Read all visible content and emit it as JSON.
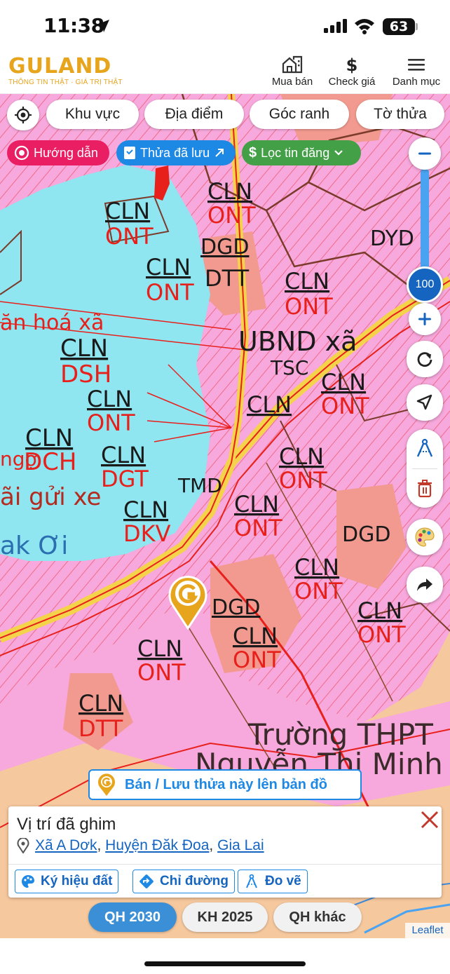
{
  "status_bar": {
    "time": "11:38",
    "battery": "63"
  },
  "header": {
    "logo": "GULAND",
    "tagline": "THÔNG TIN THẬT · GIÁ TRỊ THẬT",
    "nav": [
      {
        "label": "Mua bán",
        "icon": "house-icon"
      },
      {
        "label": "Check giá",
        "icon": "dollar-icon"
      },
      {
        "label": "Danh mục",
        "icon": "menu-icon"
      }
    ]
  },
  "filters": {
    "chips": [
      "Khu vực",
      "Địa điểm",
      "Góc ranh",
      "Tờ thửa"
    ]
  },
  "quick_actions": [
    {
      "label": "Hướng dẫn",
      "color": "#e91e63"
    },
    {
      "label": "Thửa đã lưu",
      "color": "#1e88e5"
    },
    {
      "label": "Lọc tin đăng",
      "color": "#43a047"
    }
  ],
  "zoom": {
    "value": "100"
  },
  "map_labels": {
    "hoa_xa": "ăn hoá xã",
    "cln": "CLN",
    "dsh": "DSH",
    "ont": "ONT",
    "dgd": "DGD",
    "dtt": "DTT",
    "dyd": "DYD",
    "ubnd": "UBND xã",
    "tsc": "TSC",
    "dch": "DCH",
    "dgt": "DGT",
    "tmd": "TMD",
    "dkv": "DKV",
    "gui_xe": "ãi gửi xe",
    "ak_oi": "ak Ơi",
    "ngo": "ngợ",
    "truong": "Trường THPT",
    "nguyen": "Nguyễn Thị Minh"
  },
  "cta": {
    "label": "Bán / Lưu thửa này lên bản đồ"
  },
  "info_card": {
    "title": "Vị trí đã ghim",
    "location_parts": [
      "Xã A Dơk",
      "Huyện Đăk Đoa",
      "Gia Lai"
    ],
    "separator": ",",
    "actions": [
      {
        "label": "Ký hiệu đất",
        "icon": "palette-icon"
      },
      {
        "label": "Chỉ đường",
        "icon": "directions-icon"
      },
      {
        "label": "Đo vẽ",
        "icon": "measure-icon"
      }
    ]
  },
  "plan_tabs": [
    {
      "label": "QH 2030",
      "active": true
    },
    {
      "label": "KH 2025",
      "active": false
    },
    {
      "label": "QH khác",
      "active": false
    }
  ],
  "attribution": "Leaflet",
  "colors": {
    "brand": "#e7a41d",
    "accent_blue": "#1e88e5",
    "residential_pink": "#f7a8dc",
    "water": "#8fe6f0",
    "land_orange": "#f6c89e",
    "red_lines": "#e8201c"
  }
}
